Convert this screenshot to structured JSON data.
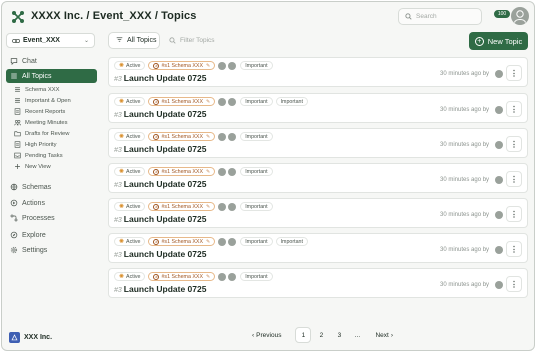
{
  "header": {
    "title": "XXXX Inc. / Event_XXX / Topics",
    "search_placeholder": "Search",
    "notification_count": "100"
  },
  "sidebar": {
    "event_name": "Event_XXX",
    "chat_label": "Chat",
    "all_topics_label": "All Topics",
    "sub_items": [
      {
        "label": "Schema XXX",
        "icon": "list-icon"
      },
      {
        "label": "Important & Open",
        "icon": "list-icon"
      },
      {
        "label": "Recent Reports",
        "icon": "report-icon"
      },
      {
        "label": "Meeting Minutes",
        "icon": "people-icon"
      },
      {
        "label": "Drafts for Review",
        "icon": "folder-icon"
      },
      {
        "label": "High Priority",
        "icon": "report-icon"
      },
      {
        "label": "Pending Tasks",
        "icon": "inbox-icon"
      },
      {
        "label": "New View",
        "icon": "plus-icon"
      }
    ],
    "sections": [
      {
        "label": "Schemas",
        "icon": "schema-icon"
      },
      {
        "label": "Actions",
        "icon": "actions-icon"
      },
      {
        "label": "Processes",
        "icon": "processes-icon"
      },
      {
        "label": "Explore",
        "icon": "explore-icon"
      },
      {
        "label": "Settings",
        "icon": "gear-icon"
      }
    ],
    "org_name": "XXX Inc."
  },
  "toolbar": {
    "all_topics_button": "All Topics",
    "filter_placeholder": "Filter Topics",
    "new_topic_button": "New Topic"
  },
  "topics": [
    {
      "status": "Active",
      "schema": "#s1 Schema XXX",
      "tags": [
        "Important"
      ],
      "number": "#3",
      "title": "Launch Update 0725",
      "time": "30 minutes ago by"
    },
    {
      "status": "Active",
      "schema": "#s1 Schema XXX",
      "tags": [
        "Important",
        "Important"
      ],
      "number": "#3",
      "title": "Launch Update 0725",
      "time": "30 minutes ago by"
    },
    {
      "status": "Active",
      "schema": "#s1 Schema XXX",
      "tags": [
        "Important"
      ],
      "number": "#3",
      "title": "Launch Update 0725",
      "time": "30 minutes ago by"
    },
    {
      "status": "Active",
      "schema": "#s1 Schema XXX",
      "tags": [
        "Important"
      ],
      "number": "#3",
      "title": "Launch Update 0725",
      "time": "30 minutes ago by"
    },
    {
      "status": "Active",
      "schema": "#s1 Schema XXX",
      "tags": [
        "Important"
      ],
      "number": "#3",
      "title": "Launch Update 0725",
      "time": "30 minutes ago by"
    },
    {
      "status": "Active",
      "schema": "#s1 Schema XXX",
      "tags": [
        "Important",
        "Important"
      ],
      "number": "#3",
      "title": "Launch Update 0725",
      "time": "30 minutes ago by"
    },
    {
      "status": "Active",
      "schema": "#s1 Schema XXX",
      "tags": [
        "Important"
      ],
      "number": "#3",
      "title": "Launch Update 0725",
      "time": "30 minutes ago by"
    }
  ],
  "pagination": {
    "previous": "Previous",
    "pages": [
      "1",
      "2",
      "3"
    ],
    "ellipsis": "...",
    "next": "Next",
    "current": "1"
  },
  "colors": {
    "accent": "#2f6b45",
    "schema_chip": "#a0541f",
    "status_star": "#d9902e",
    "org_logo": "#3e5fb3"
  }
}
